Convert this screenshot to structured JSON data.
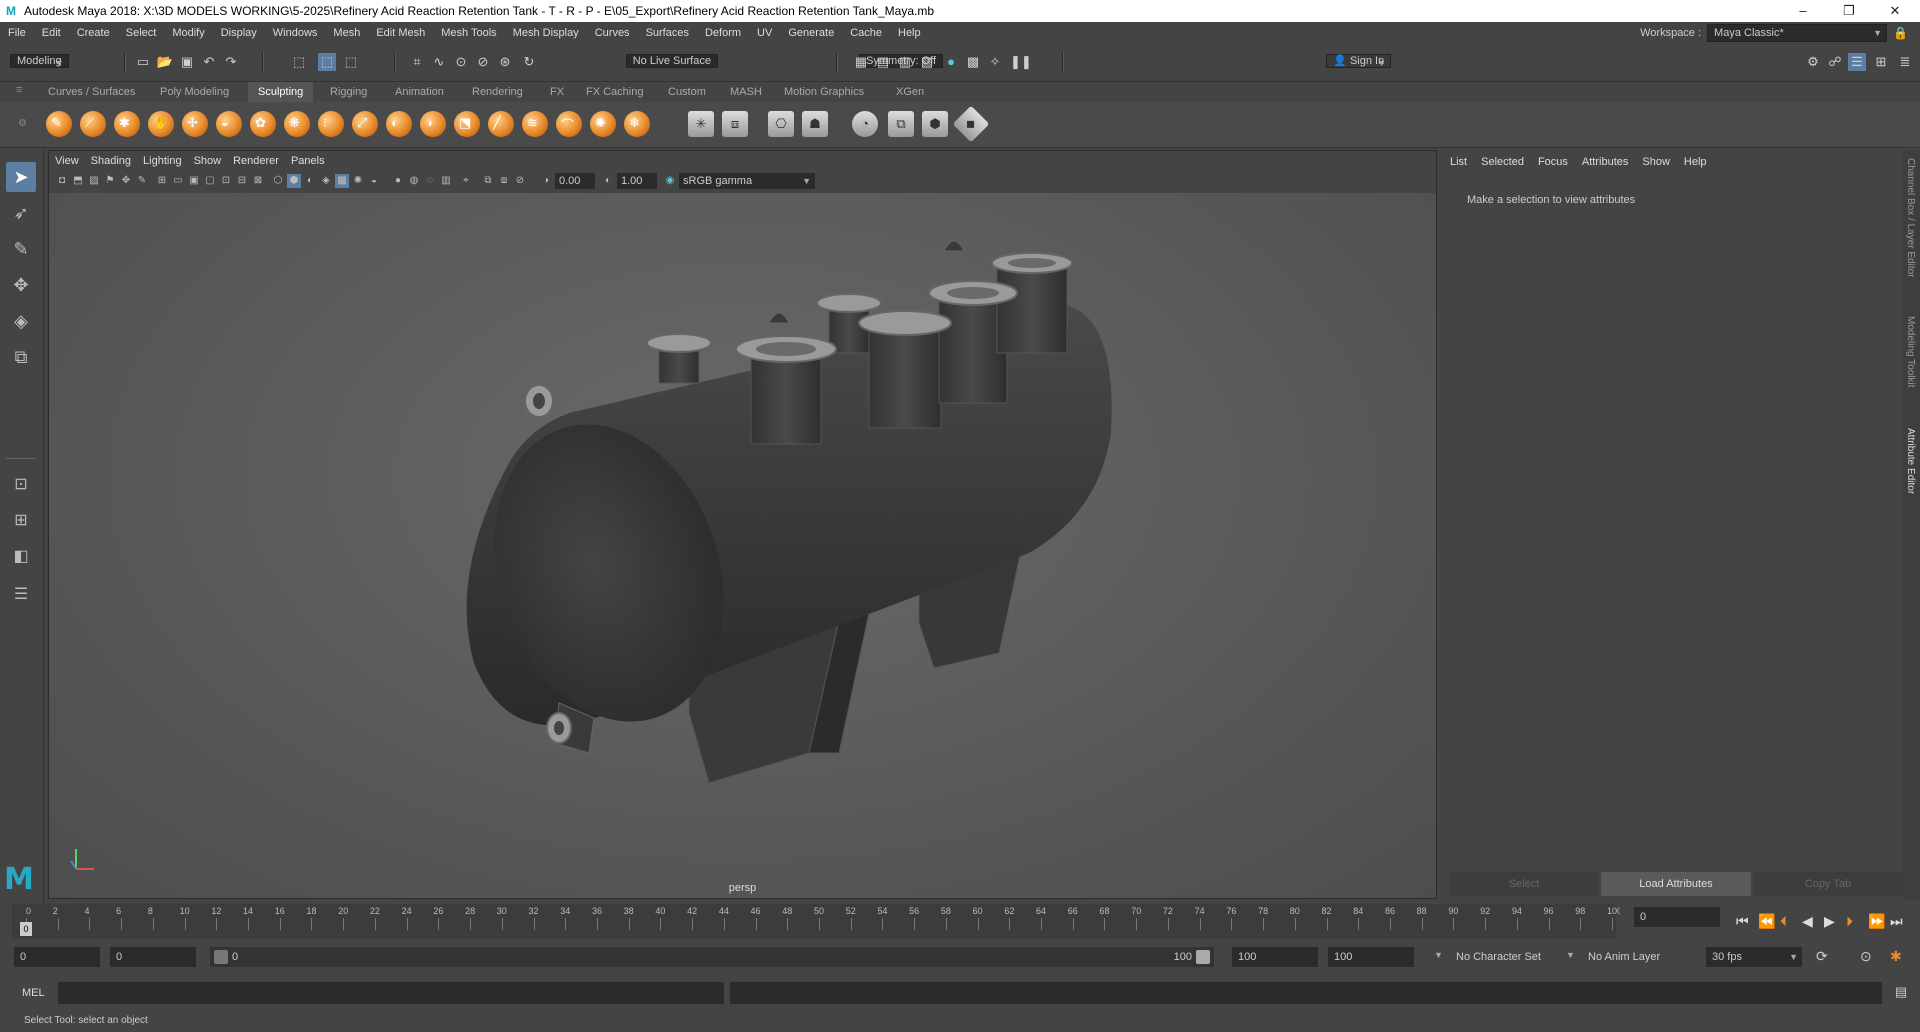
{
  "window": {
    "title": "Autodesk Maya 2018: X:\\3D MODELS WORKING\\5-2025\\Refinery Acid Reaction Retention Tank - T - R - P - E\\05_Export\\Refinery Acid Reaction Retention Tank_Maya.mb",
    "logo": "M",
    "controls": [
      "–",
      "❐",
      "✕"
    ]
  },
  "menubar": [
    "File",
    "Edit",
    "Create",
    "Select",
    "Modify",
    "Display",
    "Windows",
    "Mesh",
    "Edit Mesh",
    "Mesh Tools",
    "Mesh Display",
    "Curves",
    "Surfaces",
    "Deform",
    "UV",
    "Generate",
    "Cache",
    "Help"
  ],
  "workspace": {
    "label": "Workspace :",
    "value": "Maya Classic*"
  },
  "statusline": {
    "mode": "Modeling",
    "live_surface": "No Live Surface",
    "symmetry": "Symmetry: Off",
    "sign_in": "Sign In"
  },
  "shelf_tabs": [
    "Curves / Surfaces",
    "Poly Modeling",
    "Sculpting",
    "Rigging",
    "Animation",
    "Rendering",
    "FX",
    "FX Caching",
    "Custom",
    "MASH",
    "Motion Graphics",
    "XGen"
  ],
  "active_shelf_tab": "Sculpting",
  "viewport": {
    "menu": [
      "View",
      "Shading",
      "Lighting",
      "Show",
      "Renderer",
      "Panels"
    ],
    "exposure": "0.00",
    "gamma": "1.00",
    "color_space": "sRGB gamma",
    "camera_label": "persp"
  },
  "attribute_editor": {
    "menu": [
      "List",
      "Selected",
      "Focus",
      "Attributes",
      "Show",
      "Help"
    ],
    "message": "Make a selection to view attributes",
    "buttons": [
      "Select",
      "Load Attributes",
      "Copy Tab"
    ]
  },
  "side_tabs": [
    "Channel Box / Layer Editor",
    "Modeling Toolkit",
    "Attribute Editor"
  ],
  "timeline": {
    "ticks": [
      "0",
      "2",
      "4",
      "6",
      "8",
      "10",
      "12",
      "14",
      "16",
      "18",
      "20",
      "22",
      "24",
      "26",
      "28",
      "30",
      "32",
      "34",
      "36",
      "38",
      "40",
      "42",
      "44",
      "46",
      "48",
      "50",
      "52",
      "54",
      "56",
      "58",
      "60",
      "62",
      "64",
      "66",
      "68",
      "70",
      "72",
      "74",
      "76",
      "78",
      "80",
      "82",
      "84",
      "86",
      "88",
      "90",
      "92",
      "94",
      "96",
      "98",
      "100"
    ],
    "current_frame_marker": "0",
    "current_frame": "0"
  },
  "range": {
    "start": "0",
    "playback_start": "0",
    "slider_start": "0",
    "slider_end": "100",
    "playback_end": "100",
    "end": "100",
    "character_set": "No Character Set",
    "anim_layer": "No Anim Layer",
    "fps": "30 fps"
  },
  "command_line": {
    "lang": "MEL"
  },
  "help_line": "Select Tool: select an object"
}
